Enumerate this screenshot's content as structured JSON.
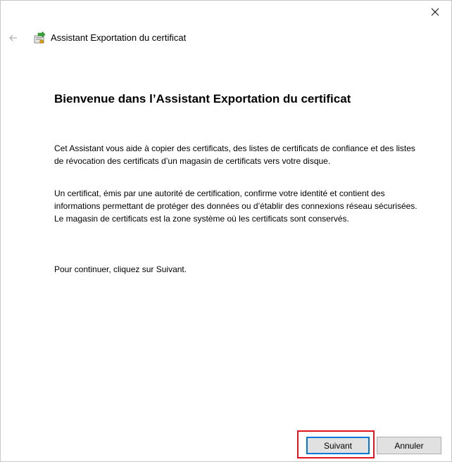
{
  "window": {
    "title": "Assistant Exportation du certificat",
    "icon": "certificate-wizard-icon",
    "close_icon": "close-icon",
    "back_icon": "back-arrow-icon"
  },
  "content": {
    "heading": "Bienvenue dans l’Assistant Exportation du certificat",
    "paragraph1": "Cet Assistant vous aide à copier des certificats, des listes de certificats de confiance et des listes de révocation des certificats d’un magasin de certificats vers votre disque.",
    "paragraph2": "Un certificat, émis par une autorité de certification, confirme votre identité et contient des informations permettant de protéger des données ou d’établir des connexions réseau sécurisées. Le magasin de certificats est la zone système où les certificats sont conservés.",
    "paragraph3": "Pour continuer, cliquez sur Suivant."
  },
  "footer": {
    "next_label": "Suivant",
    "cancel_label": "Annuler"
  },
  "colors": {
    "accent": "#0078d7",
    "highlight": "#e2141c",
    "button_bg": "#e1e1e1"
  }
}
